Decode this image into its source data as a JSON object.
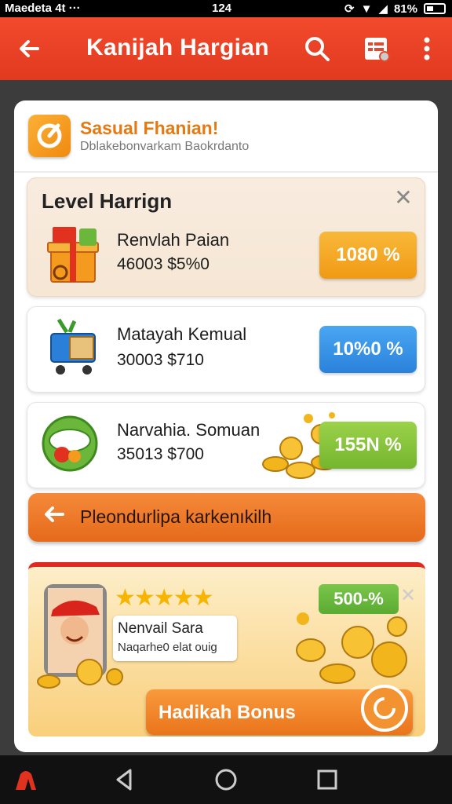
{
  "status_bar": {
    "carrier": "Maedeta 4t ···",
    "time": "124",
    "battery": "81%"
  },
  "app_bar": {
    "title": "Kanijah Hargian"
  },
  "promo": {
    "title": "Sasual Fhanian!",
    "subtitle": "Dblakebonvarkam Baokrdanto"
  },
  "levels": {
    "heading": "Level Harrign",
    "items": [
      {
        "name": "Renvlah Paian",
        "amount": "46003 $5%0",
        "percent": "1080 %",
        "color": "#f5a521"
      },
      {
        "name": "Matayah Kemual",
        "amount": "30003 $710",
        "percent": "10%0 %",
        "color": "#3a93e6"
      },
      {
        "name": "Narvahia. Somuan",
        "amount": "35013 $700",
        "percent": "155N %",
        "color": "#85c63a"
      }
    ]
  },
  "action": {
    "label": "Pleondurlipa karkenıkilh"
  },
  "bonus": {
    "title": "Nenvail Sara",
    "subtitle": "Naqarhe0 elat ouig",
    "badge": "500-%",
    "button": "Hadikah Bonus"
  },
  "colors": {
    "app_bar": "#f04a2c",
    "accent_orange": "#ef7f24",
    "green": "#6ab73b",
    "blue": "#3a93e6"
  }
}
